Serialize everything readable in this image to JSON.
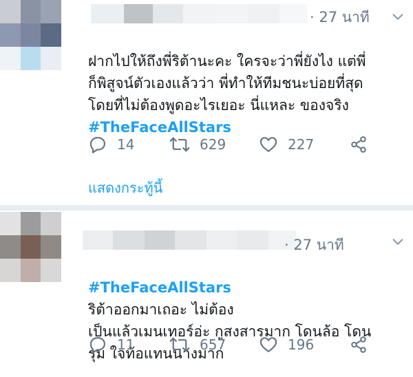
{
  "tweets": [
    {
      "time": "· 27 นาที",
      "text": "ฝากไปให้ถึงพี่ริต้านะคะ ใครจะว่าพี่ยังไง แต่พี่\nก็พิสูจน์ตัวเองแล้วว่า พี่ทำให้ทีมชนะบ่อยที่สุด\nโดยที่ไม่ต้องพูดอะไรเยอะ นี่แหละ ของจริง",
      "hashtag": "#TheFaceAllStars",
      "replies": "14",
      "retweets": "629",
      "likes": "227",
      "show_thread": "แสดงกระทู้นี้"
    },
    {
      "time": "· 27 นาที",
      "hashtag": "#TheFaceAllStars",
      "text": "ริต้าออกมาเถอะ ไม่ต้อง\nเป็นแล้วเมนเทอร์อ่ะ กูสงสารมาก โดนล้อ โดน\nรุม ใจท้อแทนนางมาก",
      "replies": "11",
      "retweets": "657",
      "likes": "196"
    }
  ],
  "icons": {
    "reply": "reply-icon",
    "retweet": "retweet-icon",
    "like": "heart-icon",
    "share": "share-icon",
    "more": "chevron-down-icon"
  },
  "colors": {
    "link": "#1da1f2",
    "meta": "#657786",
    "text": "#14171a",
    "separator": "#e6ecf0"
  }
}
